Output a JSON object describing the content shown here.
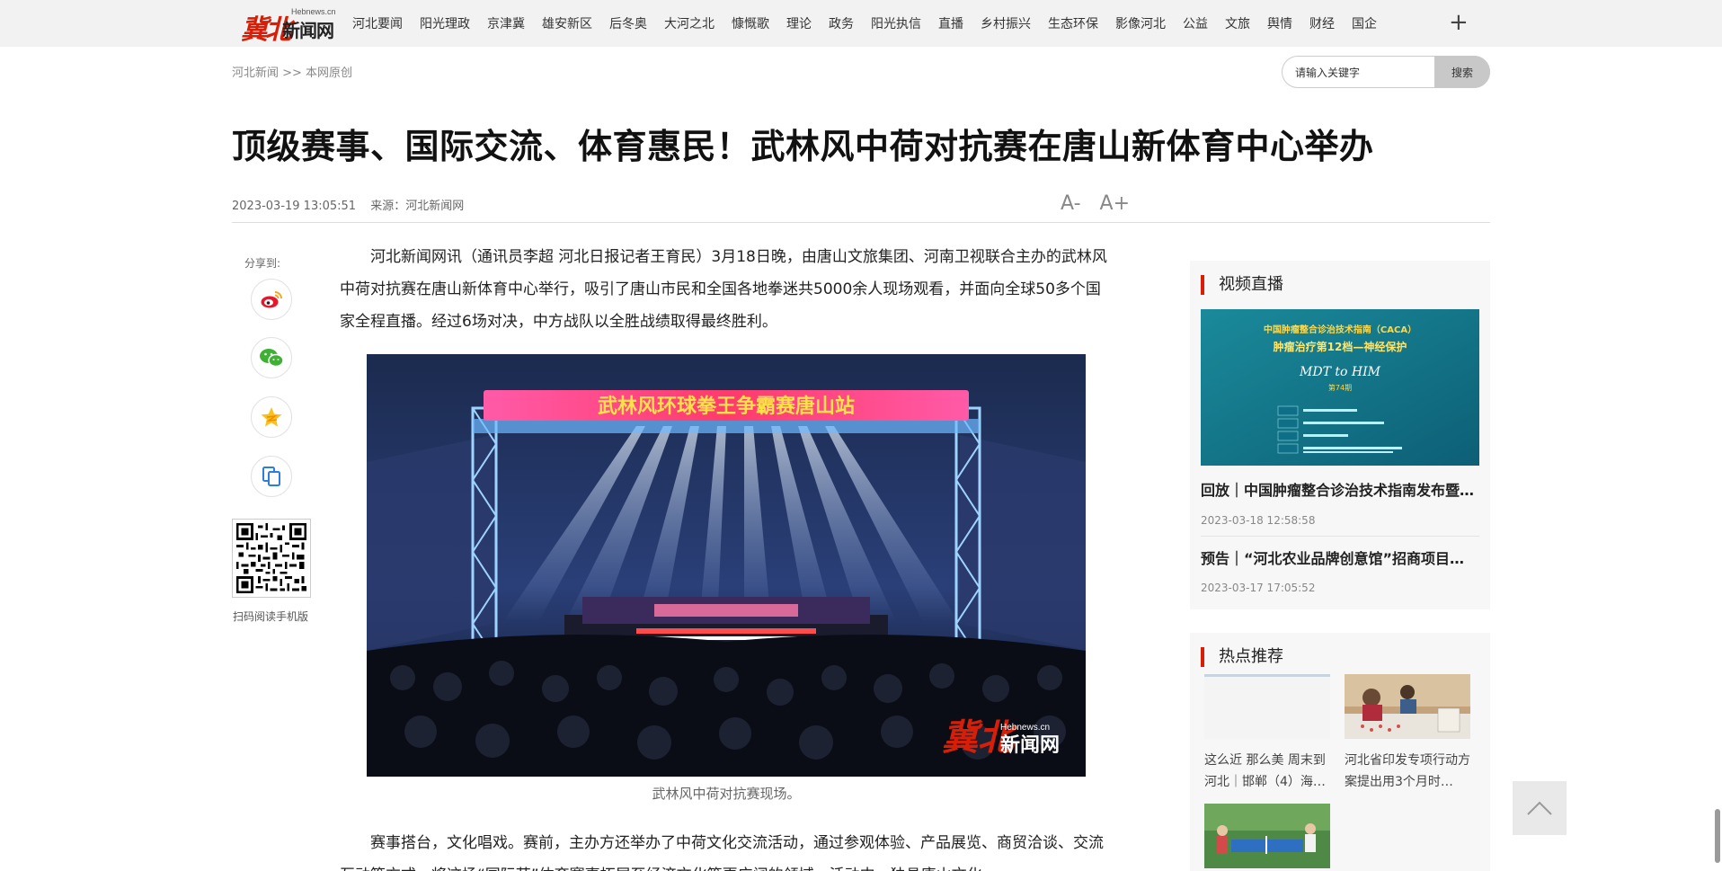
{
  "logo": {
    "mark": "冀北",
    "text": "新闻网",
    "en": "Hebnews.cn"
  },
  "nav": {
    "items": [
      "河北要闻",
      "阳光理政",
      "京津冀",
      "雄安新区",
      "后冬奥",
      "大河之北",
      "慷慨歌",
      "理论",
      "政务",
      "阳光执信",
      "直播",
      "乡村振兴",
      "生态环保",
      "影像河北",
      "公益",
      "文旅",
      "舆情",
      "财经",
      "国企"
    ],
    "more": "+"
  },
  "breadcrumb": "河北新闻 >> 本网原创",
  "search": {
    "placeholder": "请输入关键字",
    "button": "搜索"
  },
  "article": {
    "title": "顶级赛事、国际交流、体育惠民！武林风中荷对抗赛在唐山新体育中心举办",
    "date": "2023-03-19 13:05:51",
    "source": "来源：河北新闻网",
    "font_smaller": "A-",
    "font_larger": "A+",
    "p1": "河北新闻网讯（通讯员李超 河北日报记者王育民）3月18日晚，由唐山文旅集团、河南卫视联合主办的武林风中荷对抗赛在唐山新体育中心举行，吸引了唐山市民和全国各地拳迷共5000余人现场观看，并面向全球50多个国家全程直播。经过6场对决，中方战队以全胜战绩取得最终胜利。",
    "banner_text": "武林风环球拳王争霸赛唐山站",
    "watermark_mark": "冀北",
    "watermark_text": "新闻网",
    "watermark_en": "Hebnews.cn",
    "caption": "武林风中荷对抗赛现场。",
    "p2": "赛事搭台，文化唱戏。赛前，主办方还举办了中荷文化交流活动，通过参观体验、产品展览、商贸洽谈、交流互动等方式，将这场“国际范”体育赛事拓展至经济文化等更广阔的领域。活动中，独具唐山文化"
  },
  "share": {
    "label": "分享到:",
    "qr_label": "扫码阅读手机版"
  },
  "video_panel": {
    "title": "视频直播",
    "thumb_line1": "中国肿瘤整合诊治技术指南（CACA）",
    "thumb_line2": "肿瘤治疗第12档—神经保护",
    "thumb_line3": "MDT to HIM",
    "thumb_line4": "第74期",
    "items": [
      {
        "title": "回放｜中国肿瘤整合诊治技术指南发布暨…",
        "time": "2023-03-18 12:58:58"
      },
      {
        "title": "预告｜“河北农业品牌创意馆”招商项目…",
        "time": "2023-03-17 17:05:52"
      }
    ]
  },
  "hot_panel": {
    "title": "热点推荐",
    "items": [
      {
        "caption": "这么近 那么美 周末到河北｜邯郸（4）海…"
      },
      {
        "caption": "河北省印发专项行动方案提出用3个月时…"
      }
    ]
  }
}
